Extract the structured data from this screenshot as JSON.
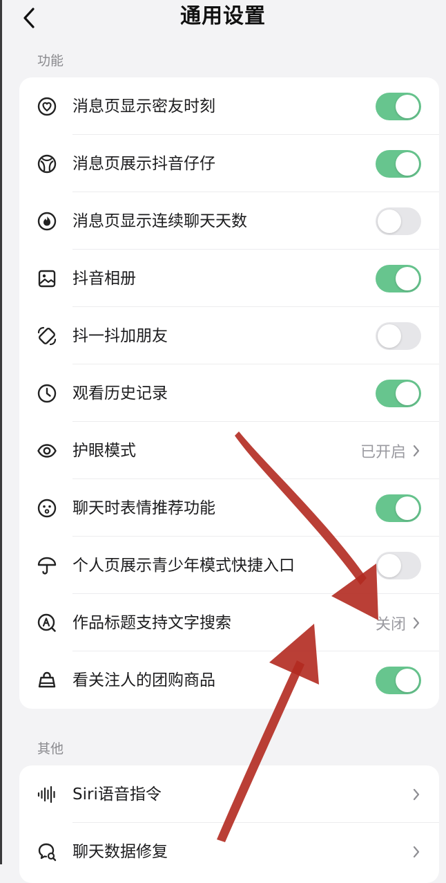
{
  "header": {
    "title": "通用设置"
  },
  "sections": {
    "features": {
      "label": "功能",
      "items": [
        {
          "label": "消息页显示密友时刻",
          "icon": "heart-circle-icon",
          "control": "toggle",
          "on": true
        },
        {
          "label": "消息页展示抖音仔仔",
          "icon": "cat-face-icon",
          "control": "toggle",
          "on": true
        },
        {
          "label": "消息页显示连续聊天天数",
          "icon": "flame-icon",
          "control": "toggle",
          "on": false
        },
        {
          "label": "抖音相册",
          "icon": "photo-icon",
          "control": "toggle",
          "on": true
        },
        {
          "label": "抖一抖加朋友",
          "icon": "shake-icon",
          "control": "toggle",
          "on": false
        },
        {
          "label": "观看历史记录",
          "icon": "clock-icon",
          "control": "toggle",
          "on": true
        },
        {
          "label": "护眼模式",
          "icon": "eye-icon",
          "control": "value",
          "value": "已开启"
        },
        {
          "label": "聊天时表情推荐功能",
          "icon": "smiley-icon",
          "control": "toggle",
          "on": true
        },
        {
          "label": "个人页展示青少年模式快捷入口",
          "icon": "umbrella-icon",
          "control": "toggle",
          "on": false
        },
        {
          "label": "作品标题支持文字搜索",
          "icon": "search-a-icon",
          "control": "value",
          "value": "关闭"
        },
        {
          "label": "看关注人的团购商品",
          "icon": "shopping-bag-icon",
          "control": "toggle",
          "on": true
        }
      ]
    },
    "other": {
      "label": "其他",
      "items": [
        {
          "label": "Siri语音指令",
          "icon": "waveform-icon",
          "control": "chevron"
        },
        {
          "label": "聊天数据修复",
          "icon": "chat-repair-icon",
          "control": "chevron"
        }
      ]
    }
  },
  "colors": {
    "toggle_on": "#67c58e",
    "toggle_off": "#e6e6e9",
    "annotation_arrow": "#b22a20"
  }
}
